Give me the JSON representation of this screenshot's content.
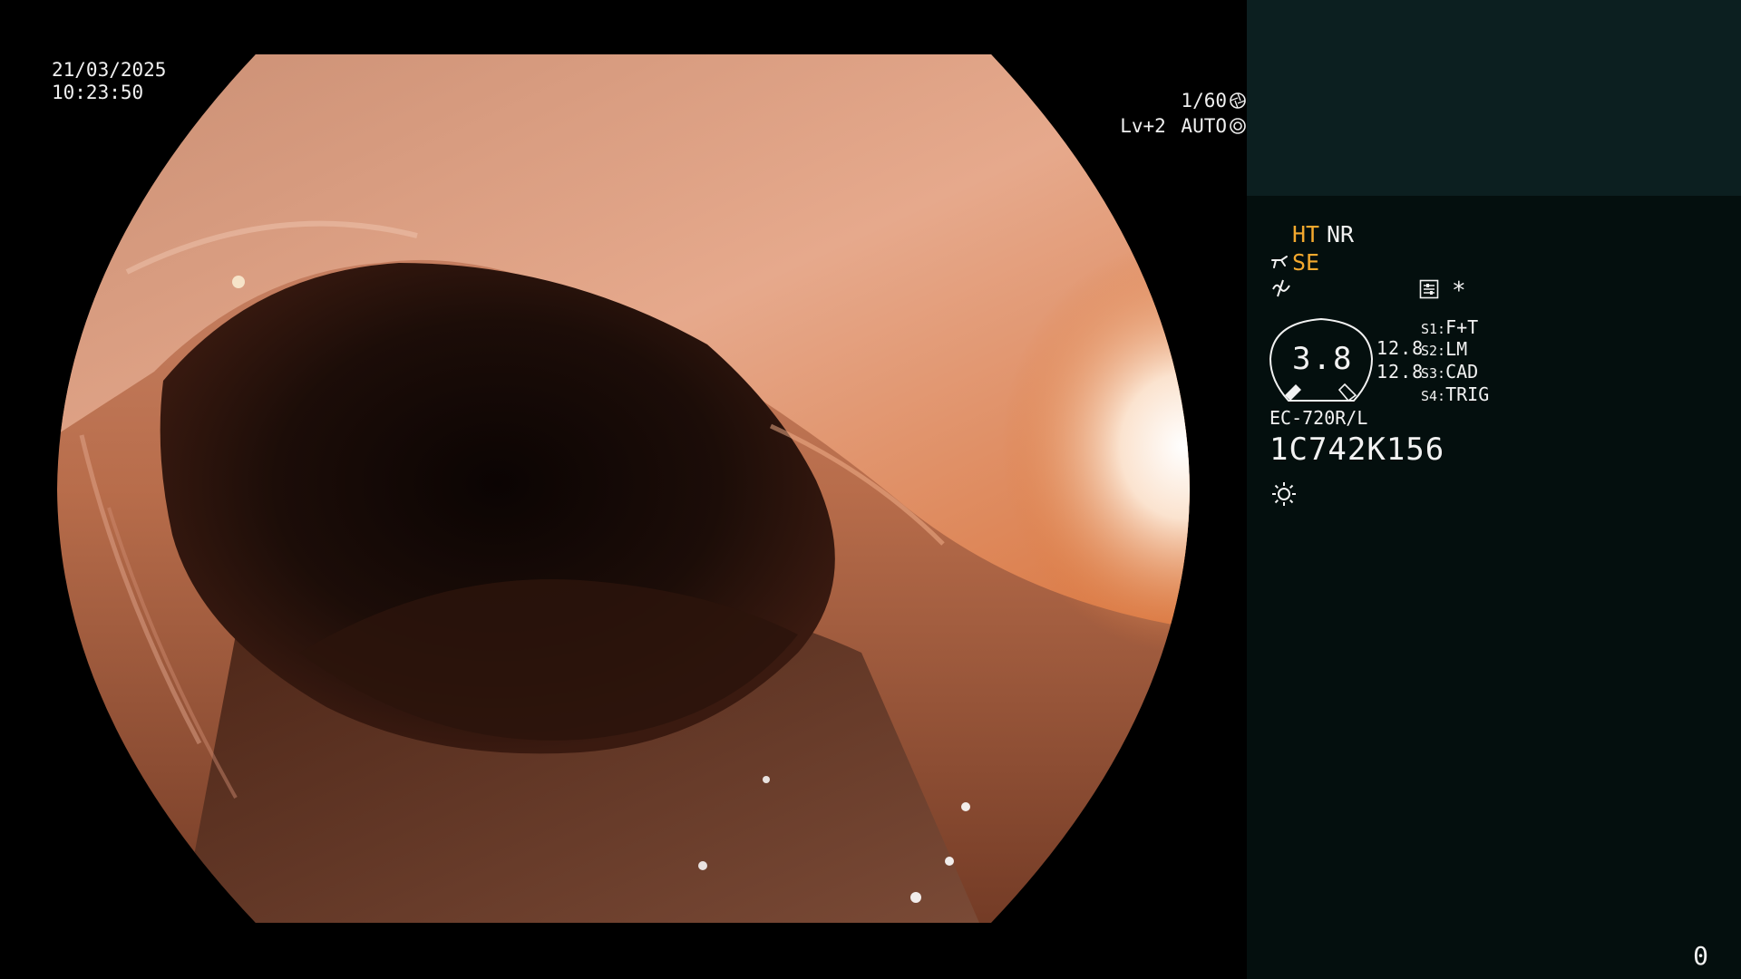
{
  "overlay": {
    "date": "21/03/2025",
    "time": "10:23:50",
    "shutter": "1/60",
    "shutter_icon": "aperture-icon",
    "level": "Lv+2",
    "iris_mode": "AUTO",
    "iris_icon": "iris-icon"
  },
  "panel": {
    "modes": {
      "ht": "HT",
      "nr": "NR",
      "se": "SE",
      "se_icon": "hand-icon",
      "wave_icon": "waveform-icon",
      "panel_icon": "settings-panel-icon",
      "asterisk": "*"
    },
    "gauge": {
      "value": "3.8",
      "line1": "12.8",
      "line2": "12.8"
    },
    "switches": [
      {
        "key": "S1:",
        "value": "F+T"
      },
      {
        "key": "S2:",
        "value": "LM"
      },
      {
        "key": "S3:",
        "value": "CAD"
      },
      {
        "key": "S4:",
        "value": "TRIG"
      }
    ],
    "scope_model": "EC-720R/L",
    "scope_serial": "1C742K156",
    "light_icon": "sun-icon",
    "counter": "0"
  },
  "colors": {
    "panel_bg": "#040f0e",
    "thumbnail_bg": "#0c1f20",
    "accent_yellow": "#f4a92e",
    "text": "#f2f2f2"
  }
}
